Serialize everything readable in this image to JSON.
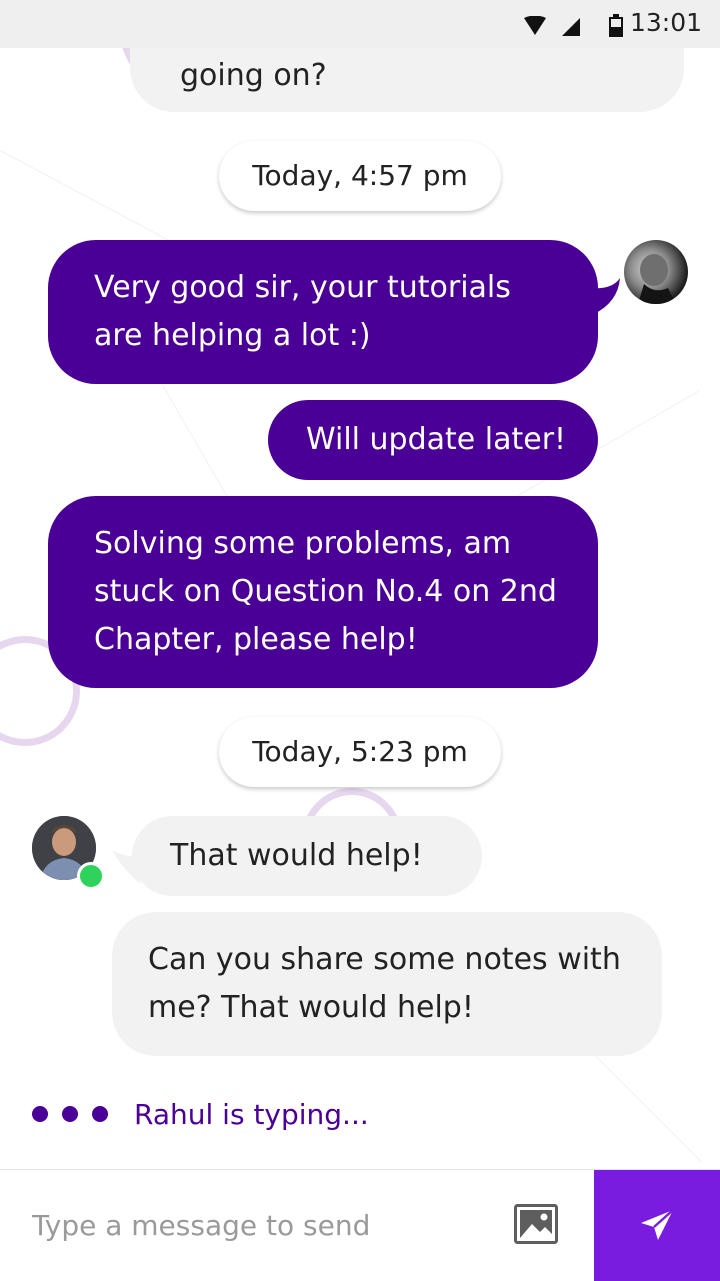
{
  "status_bar": {
    "time": "13:01",
    "icons": [
      "wifi-icon",
      "signal-icon",
      "battery-icon"
    ]
  },
  "messages": [
    {
      "type": "incoming-partial",
      "text": "going on?"
    },
    {
      "type": "date",
      "text": "Today, 4:57 pm"
    },
    {
      "type": "outgoing",
      "text": "Very good sir, your tutorials are helping a lot :)"
    },
    {
      "type": "outgoing",
      "text": "Will update later!"
    },
    {
      "type": "outgoing",
      "text": "Solving some problems, am stuck on Question No.4 on 2nd Chapter, please help!"
    },
    {
      "type": "date",
      "text": "Today, 5:23 pm"
    },
    {
      "type": "incoming",
      "text": "That would help!"
    },
    {
      "type": "incoming",
      "text": "Can you share some notes with me? That would help!"
    }
  ],
  "typing": {
    "text": "Rahul is typing..."
  },
  "composer": {
    "placeholder": "Type a message to send",
    "icons": [
      "image-icon",
      "send-icon"
    ]
  },
  "colors": {
    "accent": "#4a0096",
    "send_button": "#7a1be0",
    "incoming_bubble": "#f2f2f2",
    "online": "#2fd35b"
  }
}
